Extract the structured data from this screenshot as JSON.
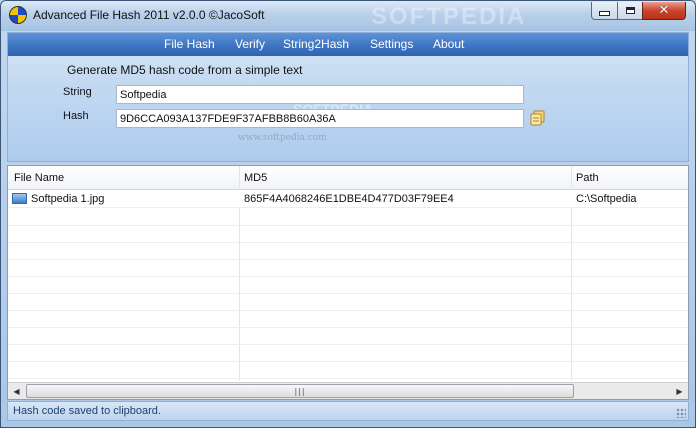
{
  "window": {
    "title": "Advanced File Hash 2011 v2.0.0 ©JacoSoft",
    "watermark": "SOFTPEDIA"
  },
  "menu": {
    "items": [
      "File Hash",
      "Verify",
      "String2Hash",
      "Settings",
      "About"
    ]
  },
  "panel": {
    "title": "Generate MD5 hash code from a simple text",
    "string_label": "String",
    "string_value": "Softpedia",
    "hash_label": "Hash",
    "hash_value": "9D6CCA093A137FDE9F37AFBB8B60A36A",
    "watermark": "SOFTPEDIA",
    "watermark_url": "www.softpedia.com"
  },
  "table": {
    "columns": [
      "File Name",
      "MD5",
      "Path"
    ],
    "rows": [
      {
        "file_name": "Softpedia 1.jpg",
        "md5": "865F4A4068246E1DBE4D477D03F79EE4",
        "path": "C:\\Softpedia"
      }
    ]
  },
  "status": {
    "text": "Hash code saved to clipboard."
  },
  "colors": {
    "menubar": "#3b73c1",
    "accent": "#2f63ad"
  },
  "icons": [
    "app-icon",
    "minimize-icon",
    "maximize-icon",
    "close-icon",
    "copy-to-clipboard-icon",
    "image-file-icon",
    "scroll-left-icon",
    "scroll-right-icon",
    "resize-grip-icon"
  ]
}
